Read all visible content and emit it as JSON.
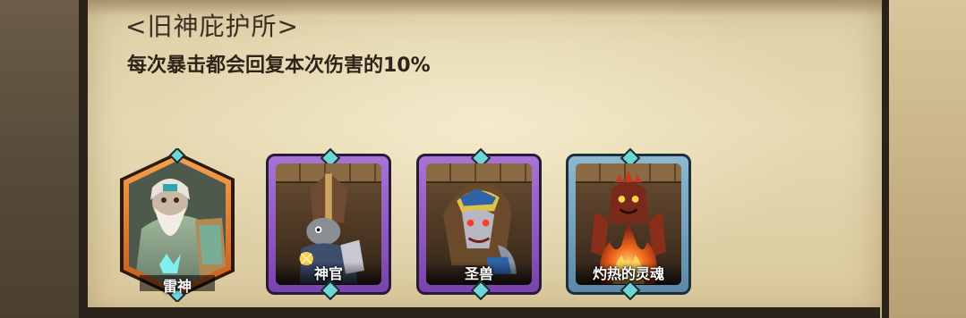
{
  "panel": {
    "title": "<旧神庇护所>",
    "description": "每次暴击都会回复本次伤害的10%"
  },
  "cards": [
    {
      "name": "雷神",
      "rarity": "orange",
      "icon": "thunder-god-portrait"
    },
    {
      "name": "神官",
      "rarity": "purple",
      "icon": "priest-portrait"
    },
    {
      "name": "圣兽",
      "rarity": "purple",
      "icon": "holy-beast-portrait"
    },
    {
      "name": "灼热的灵魂",
      "rarity": "blue",
      "icon": "scorching-soul-portrait"
    }
  ],
  "colors": {
    "parchment": "#e6d9b2",
    "orange_frame": "#e07a2c",
    "purple_frame": "#8e57c2",
    "blue_frame": "#7aa8c4",
    "gem": "#6fd6d8"
  }
}
